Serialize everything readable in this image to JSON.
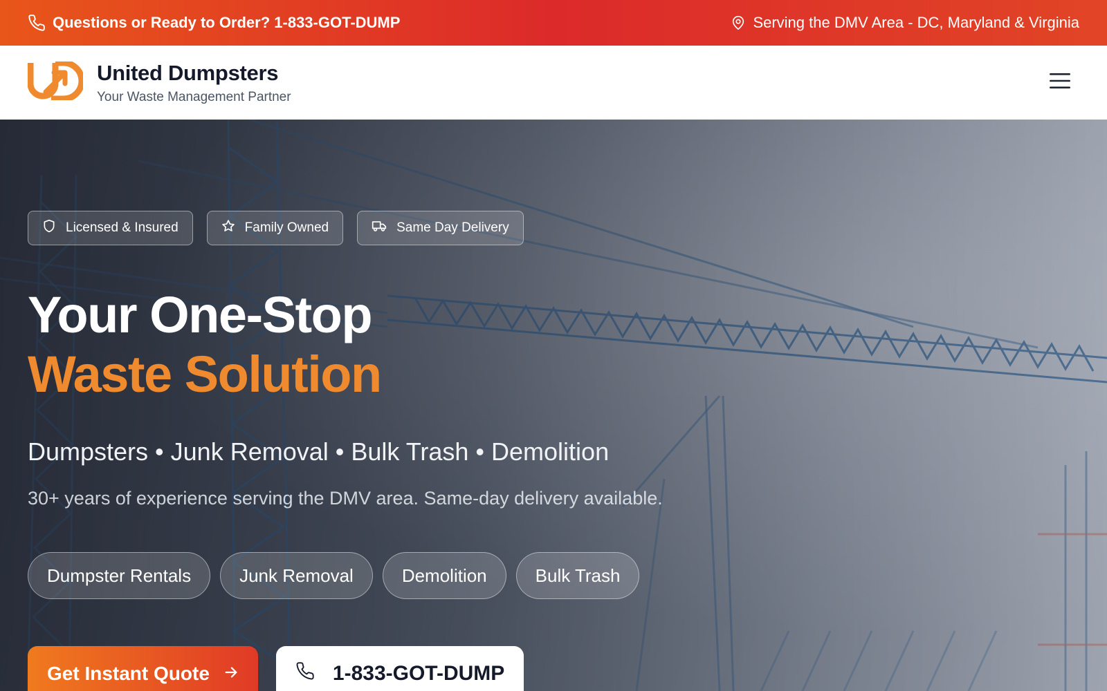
{
  "topbar": {
    "phone_cta": "Questions or Ready to Order? 1-833-GOT-DUMP",
    "service_area": "Serving the DMV Area - DC, Maryland & Virginia"
  },
  "header": {
    "brand_name": "United Dumpsters",
    "tagline": "Your Waste Management Partner",
    "logo_icon": "ud-logo-icon",
    "menu_icon": "hamburger-menu-icon"
  },
  "hero": {
    "badges": [
      {
        "label": "Licensed & Insured",
        "icon": "shield-icon"
      },
      {
        "label": "Family Owned",
        "icon": "star-icon"
      },
      {
        "label": "Same Day Delivery",
        "icon": "truck-icon"
      }
    ],
    "headline_line1": "Your One-Stop",
    "headline_line2": "Waste Solution",
    "services_line": "Dumpsters • Junk Removal • Bulk Trash • Demolition",
    "experience_line": "30+ years of experience serving the DMV area. Same-day delivery available.",
    "service_pills": [
      "Dumpster Rentals",
      "Junk Removal",
      "Demolition",
      "Bulk Trash"
    ],
    "primary_cta": "Get Instant Quote",
    "secondary_cta": "1-833-GOT-DUMP"
  },
  "colors": {
    "brand_orange": "#f08a2e",
    "topbar_red": "#dc2a2a",
    "dark_text": "#141a2a"
  }
}
